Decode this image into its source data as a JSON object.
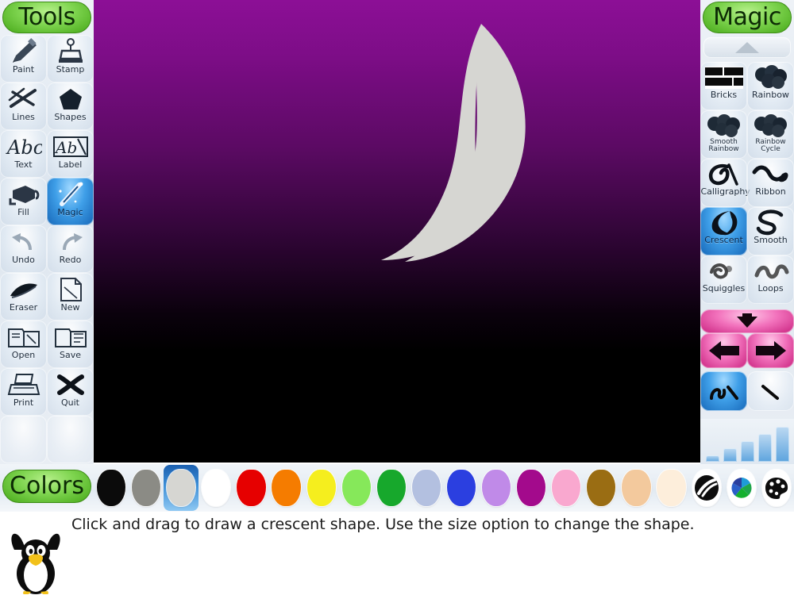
{
  "app": {
    "name": "Tux Paint"
  },
  "tools_panel": {
    "title": "Tools",
    "items": [
      {
        "label": "Paint",
        "icon": "paintbrush-icon",
        "selected": false
      },
      {
        "label": "Stamp",
        "icon": "stamp-icon",
        "selected": false
      },
      {
        "label": "Lines",
        "icon": "lines-icon",
        "selected": false
      },
      {
        "label": "Shapes",
        "icon": "pentagon-shape-icon",
        "selected": false
      },
      {
        "label": "Text",
        "icon": "abc-text-icon",
        "selected": false
      },
      {
        "label": "Label",
        "icon": "label-icon",
        "selected": false
      },
      {
        "label": "Fill",
        "icon": "paint-bucket-icon",
        "selected": false
      },
      {
        "label": "Magic",
        "icon": "magic-wand-icon",
        "selected": true
      },
      {
        "label": "Undo",
        "icon": "undo-arrow-icon",
        "selected": false
      },
      {
        "label": "Redo",
        "icon": "redo-arrow-icon",
        "selected": false
      },
      {
        "label": "Eraser",
        "icon": "eraser-icon",
        "selected": false
      },
      {
        "label": "New",
        "icon": "new-page-icon",
        "selected": false
      },
      {
        "label": "Open",
        "icon": "open-folder-icon",
        "selected": false
      },
      {
        "label": "Save",
        "icon": "save-disk-icon",
        "selected": false
      },
      {
        "label": "Print",
        "icon": "printer-icon",
        "selected": false
      },
      {
        "label": "Quit",
        "icon": "quit-x-icon",
        "selected": false
      }
    ]
  },
  "magic_panel": {
    "title": "Magic",
    "scroll_up_icon": "triangle-up-icon",
    "scroll_up_disabled": true,
    "items": [
      {
        "label": "Bricks",
        "icon": "bricks-icon",
        "selected": false
      },
      {
        "label": "Rainbow",
        "icon": "rainbow-blob-icon",
        "selected": false
      },
      {
        "label": "Smooth Rainbow",
        "icon": "smooth-rainbow-icon",
        "selected": false
      },
      {
        "label": "Rainbow Cycle",
        "icon": "rainbow-cycle-icon",
        "selected": false
      },
      {
        "label": "Calligraphy",
        "icon": "calligraphy-icon",
        "selected": false
      },
      {
        "label": "Ribbon",
        "icon": "ribbon-icon",
        "selected": false
      },
      {
        "label": "Crescent",
        "icon": "crescent-icon",
        "selected": true
      },
      {
        "label": "Smooth",
        "icon": "smooth-s-icon",
        "selected": false
      },
      {
        "label": "Squiggles",
        "icon": "squiggles-icon",
        "selected": false
      },
      {
        "label": "Loops",
        "icon": "loops-icon",
        "selected": false
      }
    ],
    "nav": {
      "down_icon": "arrow-down-icon",
      "left_icon": "arrow-left-icon",
      "right_icon": "arrow-right-icon"
    },
    "mode_buttons": [
      {
        "icon": "paint-stroke-icon",
        "selected": true
      },
      {
        "icon": "fill-stroke-icon",
        "selected": false
      }
    ],
    "size_selector": {
      "steps": 5,
      "selected_index": 2
    }
  },
  "canvas": {
    "background_top_color": "#8c0f96",
    "background_bottom_color": "#000000",
    "drawing": {
      "shape": "crescent-moon",
      "color": "#d6d6d2"
    }
  },
  "colors_bar": {
    "title": "Colors",
    "selected_index": 2,
    "swatches": [
      {
        "name": "black",
        "hex": "#0b0b0b"
      },
      {
        "name": "gray",
        "hex": "#8b8b85"
      },
      {
        "name": "light-gray",
        "hex": "#d6d6d2"
      },
      {
        "name": "white",
        "hex": "#ffffff"
      },
      {
        "name": "red",
        "hex": "#e60000"
      },
      {
        "name": "orange",
        "hex": "#f57c00"
      },
      {
        "name": "yellow",
        "hex": "#f5ee1e"
      },
      {
        "name": "light-green",
        "hex": "#86e85a"
      },
      {
        "name": "green",
        "hex": "#17a82c"
      },
      {
        "name": "light-blue",
        "hex": "#b3c0e0"
      },
      {
        "name": "blue",
        "hex": "#2b3fe0"
      },
      {
        "name": "lavender",
        "hex": "#c08ae8"
      },
      {
        "name": "magenta",
        "hex": "#a30a8c"
      },
      {
        "name": "pink",
        "hex": "#f9a8cf"
      },
      {
        "name": "brown",
        "hex": "#9a6d13"
      },
      {
        "name": "tan",
        "hex": "#f3c99d"
      },
      {
        "name": "cream",
        "hex": "#fdeedb"
      }
    ],
    "extra_buttons": [
      {
        "name": "paint-mixer-button",
        "icon": "paint-mixer-icon"
      },
      {
        "name": "color-wheel-button",
        "icon": "color-wheel-icon"
      },
      {
        "name": "palette-button",
        "icon": "palette-icon"
      }
    ]
  },
  "status": {
    "mascot": "tux-penguin",
    "text": "Click and drag to draw a crescent shape. Use the size option to change the shape."
  }
}
